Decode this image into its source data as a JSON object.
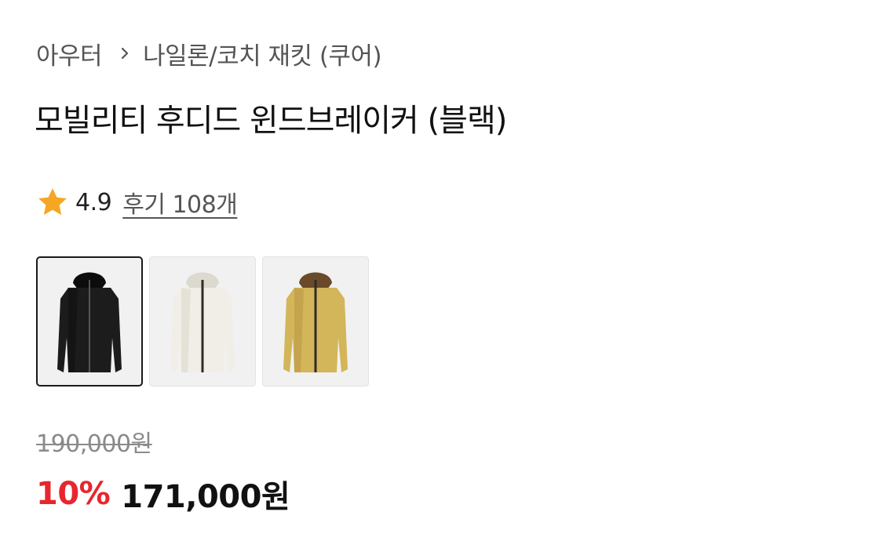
{
  "breadcrumb": {
    "category": "아우터",
    "subcategory": "나일론/코치 재킷 (쿠어)"
  },
  "product": {
    "title": "모빌리티 후디드 윈드브레이커 (블랙)"
  },
  "rating": {
    "score": "4.9",
    "reviews_label": "후기 108개",
    "star_color": "#F5A623"
  },
  "color_options": [
    {
      "name": "black",
      "body": "#1c1c1c",
      "shade": "#0c0c0c",
      "zip": "#555555",
      "selected": true
    },
    {
      "name": "ivory",
      "body": "#f0eee6",
      "shade": "#dcd9cf",
      "zip": "#2c2c2c",
      "selected": false
    },
    {
      "name": "mustard",
      "body": "#d3b55a",
      "shade": "#b8973f",
      "zip": "#2c2c2c",
      "hood_lining": "#6b4a2a",
      "selected": false
    }
  ],
  "price": {
    "original": "190,000원",
    "discount": "10%",
    "sale": "171,000원",
    "discount_color": "#E8262D"
  }
}
